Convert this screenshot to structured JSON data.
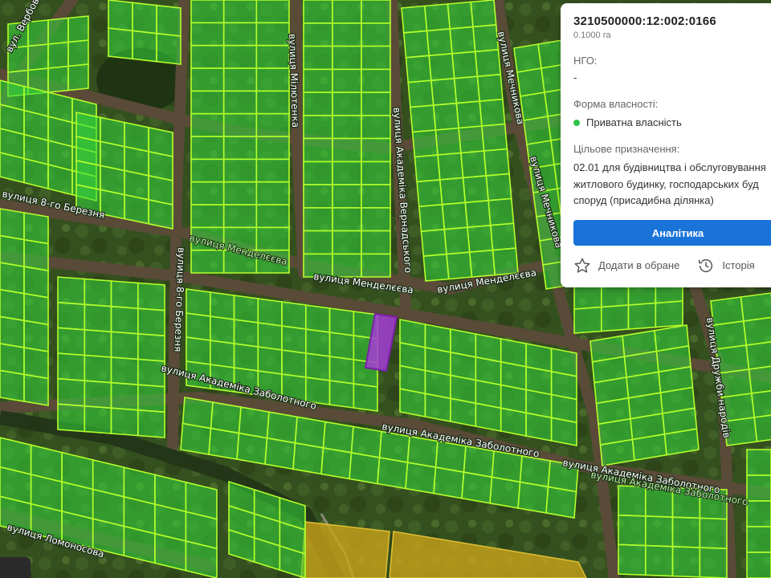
{
  "map": {
    "streets": [
      "вул. Вербова",
      "вулиця Мілютенка",
      "вулиця Академіка Вернадського",
      "вулиця Мечникова",
      "вулиця Мечникова",
      "вулиця 8-го Березня",
      "вулиця 8-го Березня",
      "вулиця Менделєєва",
      "вулиця Менделєєва",
      "вулиця Менделєєва",
      "вулиця Академіка Заболотного",
      "вулиця Академіка Заболотного",
      "вулиця Академіка Заболотного",
      "вулиця Академіка Заболотного",
      "вулиця Дружби народів",
      "вулиця Ломоносова"
    ],
    "colors": {
      "parcel_fill": "#35d83c",
      "parcel_stroke": "#b4ff2a",
      "selected_fill": "#a33cd6",
      "commercial_fill": "#c9a21a"
    }
  },
  "panel": {
    "cadastral_number": "3210500000:12:002:0166",
    "area": "0.1000 га",
    "ngo_label": "НГО:",
    "ngo_value": "-",
    "ownership_label": "Форма власності:",
    "ownership_value": "Приватна власність",
    "purpose_label": "Цільове призначення:",
    "purpose_lines": [
      "02.01 для будівництва і обслуговування",
      "житлового будинку, господарських буд",
      "споруд (присадибна ділянка)"
    ],
    "analytics_button": "Аналітика",
    "favorite_label": "Додати в обране",
    "history_label": "Історія",
    "status_color": "#2ec24a",
    "accent_color": "#1a73d9"
  }
}
